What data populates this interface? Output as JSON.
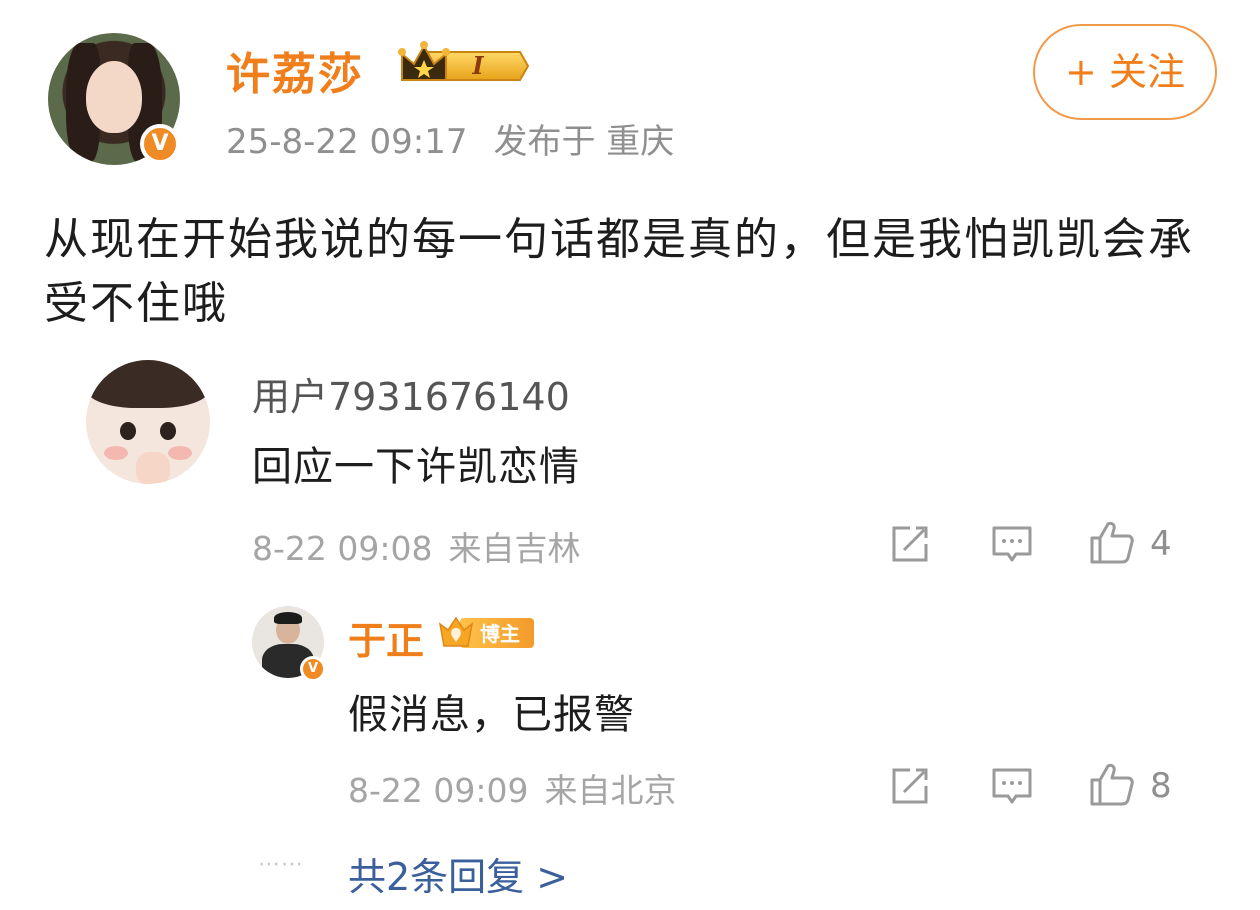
{
  "post": {
    "author": "许荔莎",
    "level_badge": "I",
    "verified_mark": "V",
    "time": "25-8-22 09:17",
    "location": "发布于 重庆",
    "follow_label": "+ 关注",
    "text": "从现在开始我说的每一句话都是真的，但是我怕凯凯会承受不住哦"
  },
  "comment": {
    "user": "用户7931676140",
    "text": "回应一下许凯恋情",
    "time": "8-22 09:08",
    "location": "来自吉林",
    "likes": "4"
  },
  "reply": {
    "user": "于正",
    "badge_label": "博主",
    "verified_mark": "V",
    "text": "假消息，已报警",
    "time": "8-22 09:09",
    "location": "来自北京",
    "likes": "8"
  },
  "more_replies": {
    "dots": "⋯⋯",
    "label": "共2条回复 >"
  },
  "icons": {
    "repost": "repost-icon",
    "comment": "comment-icon",
    "like": "thumb-up-icon"
  },
  "colors": {
    "accent": "#f07e1a",
    "link": "#3a5f9b",
    "muted": "#8f8f8f"
  }
}
